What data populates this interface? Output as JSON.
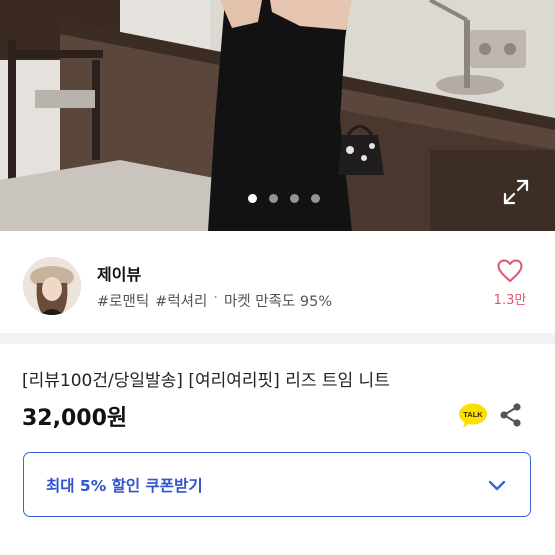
{
  "gallery": {
    "dots": [
      true,
      false,
      false,
      false
    ],
    "expand_icon": "expand-icon"
  },
  "seller": {
    "name": "제이뷰",
    "tags": [
      "#로맨틱",
      "#럭셔리"
    ],
    "separator": "·",
    "satisfaction": "마켓 만족도 95%",
    "like_count": "1.3만"
  },
  "product": {
    "title": "[리뷰100건/당일발송] [여리여리핏] 리즈 트임 니트",
    "price": "32,000원",
    "talk_label": "TALK"
  },
  "coupon": {
    "label": "최대 5% 할인 쿠폰받기"
  },
  "colors": {
    "accent": "#3e63d8",
    "like": "#e0556b",
    "talk_bg": "#f9e000"
  }
}
